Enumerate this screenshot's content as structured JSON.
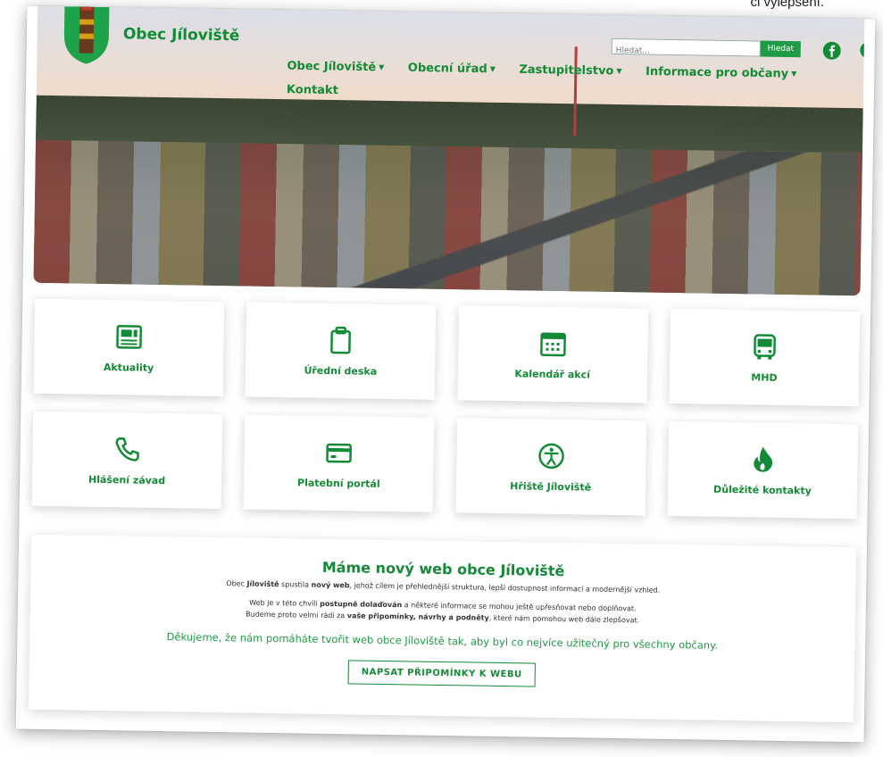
{
  "corner_text": "ci vylepšení.",
  "header": {
    "site_title": "Obec Jíloviště",
    "search": {
      "placeholder": "Hledat...",
      "button_label": "Hledat"
    },
    "nav": [
      {
        "label": "Obec Jíloviště",
        "has_dropdown": true
      },
      {
        "label": "Obecní úřad",
        "has_dropdown": true
      },
      {
        "label": "Zastupitelstvo",
        "has_dropdown": true
      },
      {
        "label": "Informace pro občany",
        "has_dropdown": true
      },
      {
        "label": "Kontakt",
        "has_dropdown": false
      }
    ]
  },
  "tiles": [
    {
      "label": "Aktuality",
      "icon": "newspaper-icon"
    },
    {
      "label": "Úřední deska",
      "icon": "clipboard-icon"
    },
    {
      "label": "Kalendář akcí",
      "icon": "calendar-icon"
    },
    {
      "label": "MHD",
      "icon": "bus-icon"
    },
    {
      "label": "Hlášení závad",
      "icon": "phone-icon"
    },
    {
      "label": "Platební portál",
      "icon": "credit-card-icon"
    },
    {
      "label": "Hřiště Jíloviště",
      "icon": "accessibility-icon"
    },
    {
      "label": "Důležité kontakty",
      "icon": "fire-icon"
    }
  ],
  "announcement": {
    "title": "Máme nový web obce Jíloviště",
    "line1_pre": "Obec ",
    "line1_b1": "Jíloviště",
    "line1_mid": " spustila ",
    "line1_b2": "nový web",
    "line1_post": ", jehož cílem je přehlednější struktura, lepší dostupnost informací a modernější vzhled.",
    "line2_pre": "Web je v této chvíli ",
    "line2_b": "postupně dolaďován",
    "line2_post": " a některé informace se mohou ještě upřesňovat nebo doplňovat.",
    "line3_pre": "Budeme proto velmi rádi za ",
    "line3_b": "vaše připomínky, návrhy a podněty",
    "line3_post": ", které nám pomohou web dále zlepšovat.",
    "thanks": "Děkujeme, že nám pomáháte tvořit web obce Jíloviště tak, aby byl co nejvíce užitečný pro všechny občany.",
    "button_label": "NAPSAT PŘIPOMÍNKY K WEBU"
  },
  "colors": {
    "brand_green": "#138a36",
    "accent_green": "#1f9a45"
  }
}
